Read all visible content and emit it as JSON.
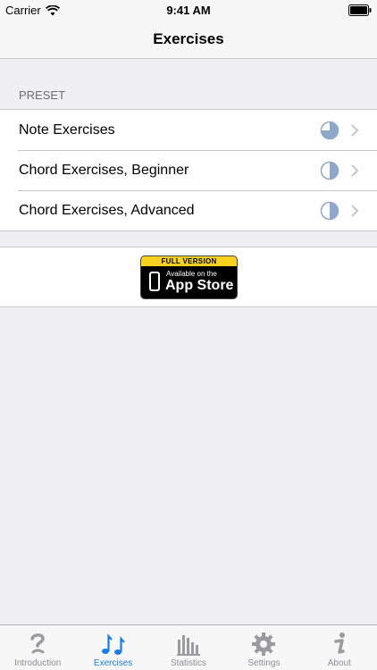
{
  "status_bar": {
    "carrier": "Carrier",
    "time": "9:41 AM"
  },
  "nav": {
    "title": "Exercises"
  },
  "section": {
    "header": "PRESET"
  },
  "rows": [
    {
      "label": "Note Exercises",
      "progress": 0.75
    },
    {
      "label": "Chord Exercises, Beginner",
      "progress": 0.5
    },
    {
      "label": "Chord Exercises, Advanced",
      "progress": 0.5
    }
  ],
  "ad": {
    "ribbon": "FULL VERSION",
    "line1": "Available on the",
    "line2": "App Store"
  },
  "tabs": [
    {
      "label": "Introduction",
      "icon": "question-icon",
      "active": false
    },
    {
      "label": "Exercises",
      "icon": "music-notes-icon",
      "active": true
    },
    {
      "label": "Statistics",
      "icon": "bar-chart-icon",
      "active": false
    },
    {
      "label": "Settings",
      "icon": "gear-icon",
      "active": false
    },
    {
      "label": "About",
      "icon": "info-icon",
      "active": false
    }
  ],
  "colors": {
    "accent": "#1a7ee8",
    "progress_fill": "#8ea7cb",
    "inactive": "#8e8e93"
  }
}
